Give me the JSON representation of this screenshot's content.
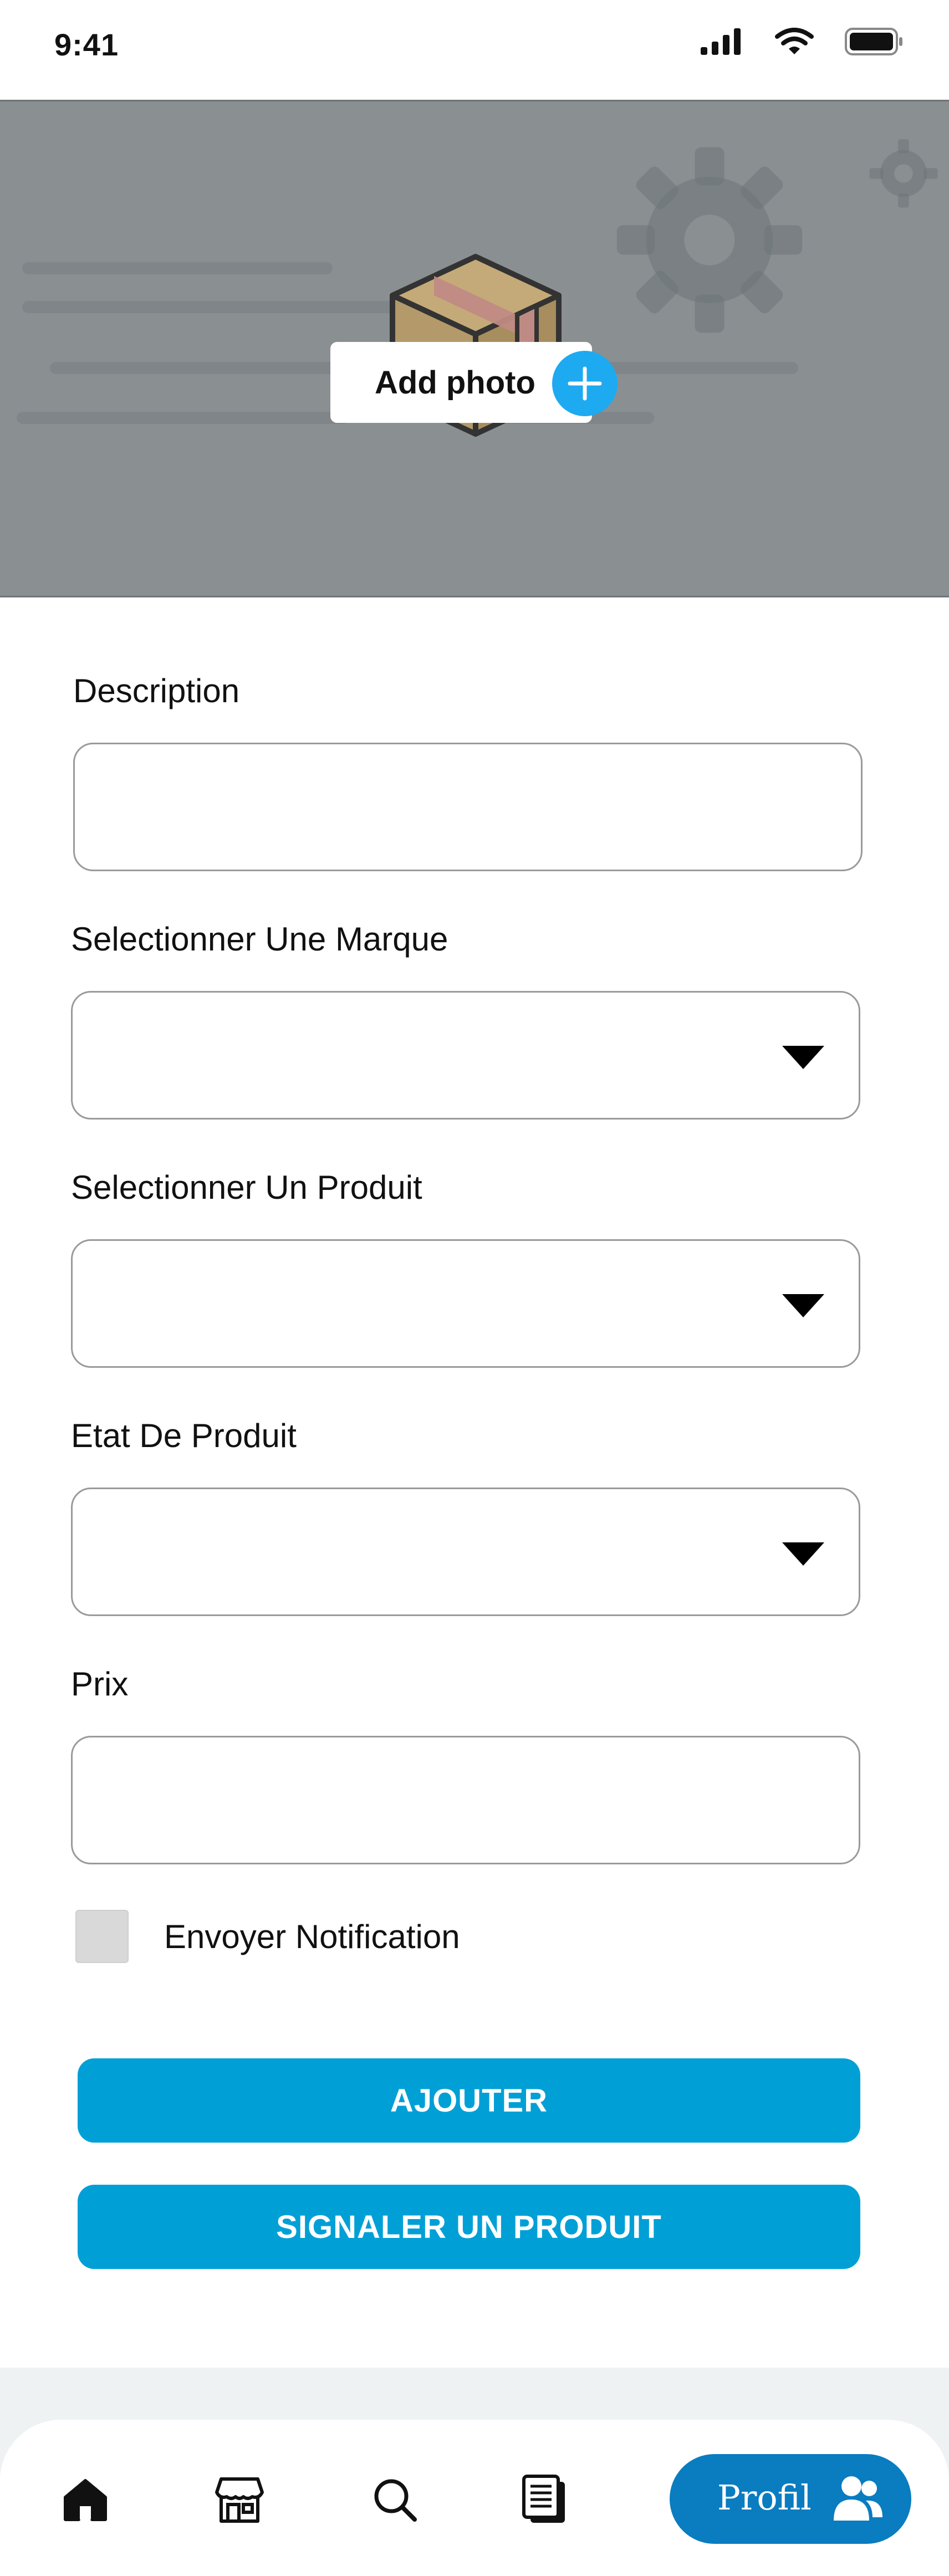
{
  "status_bar": {
    "time": "9:41"
  },
  "hero": {
    "add_photo_label": "Add photo"
  },
  "form": {
    "description_label": "Description",
    "description_value": "",
    "brand_label": "Selectionner Une Marque",
    "brand_value": "",
    "product_label": "Selectionner Un Produit",
    "product_value": "",
    "condition_label": "Etat De Produit",
    "condition_value": "",
    "price_label": "Prix",
    "price_value": "",
    "notify_label": "Envoyer Notification",
    "notify_checked": false
  },
  "buttons": {
    "add_label": "AJOUTER",
    "report_label": "SIGNALER UN PRODUIT"
  },
  "bottom_nav": {
    "items": [
      "home-icon",
      "store-icon",
      "search-icon",
      "documents-icon"
    ],
    "active_label": "Profil",
    "active_icon": "users-icon",
    "active_color": "#0a7cc0"
  },
  "colors": {
    "primary_button": "#00a0d6",
    "add_photo_accent": "#1eaaf0",
    "hero_background": "#8a8f92"
  }
}
